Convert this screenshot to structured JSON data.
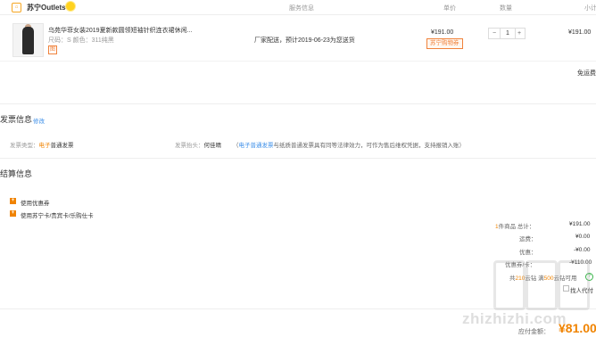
{
  "store": {
    "name": "苏宁Outlets"
  },
  "columns": {
    "service": "服务信息",
    "unit_price": "单价",
    "quantity": "数量",
    "subtotal": "小计"
  },
  "product": {
    "title": "乌苑华菲女装2019夏新款圆领短袖针织连衣裙休闲...",
    "spec": "尺码：S   颜色：311纯黑",
    "badge": "图",
    "shipping": "厂家配送，预计2019-06-23为您送货",
    "unit_price": "¥191.00",
    "promo_tag": "苏宁购物券",
    "quantity": "1",
    "minus": "−",
    "plus": "+",
    "subtotal": "¥191.00"
  },
  "free_shipping": "免运费",
  "invoice": {
    "title": "发票信息",
    "edit": "修改",
    "type_label": "发票类型：",
    "type_value_hl": "电子",
    "type_value": "普通发票",
    "header_label": "发票抬头：",
    "header_value": "何佳晴",
    "note_open": "（",
    "note_hl": "电子普通发票",
    "note_rest": "与纸质普通发票具有同等法律效力，可作为售后维权凭据，支持报销入账）"
  },
  "settlement": {
    "title": "结算信息",
    "options": [
      {
        "icon": "plus-icon",
        "label": "使用优惠券"
      },
      {
        "icon": "plus-icon",
        "label": "使用苏宁卡/贵宾卡/乐购仕卡"
      }
    ],
    "summary": {
      "items_count": "1",
      "items_label": "件商品 总计：",
      "items_value": "¥191.00",
      "freight_label": "运费：",
      "freight_value": "¥0.00",
      "discount_label": "优惠：",
      "discount_value": "-¥0.00",
      "card_label": "优惠券/卡：",
      "card_value": "-¥110.00",
      "points_prefix": "共",
      "points_count": "210",
      "points_mid": "云钻 满",
      "points_min": "500",
      "points_suffix": "云钻可用",
      "proxy_pay": "找人代付",
      "total_label": "应付金额：",
      "total_value": "¥81.00"
    }
  },
  "watermark": "zhizhizhi.com"
}
